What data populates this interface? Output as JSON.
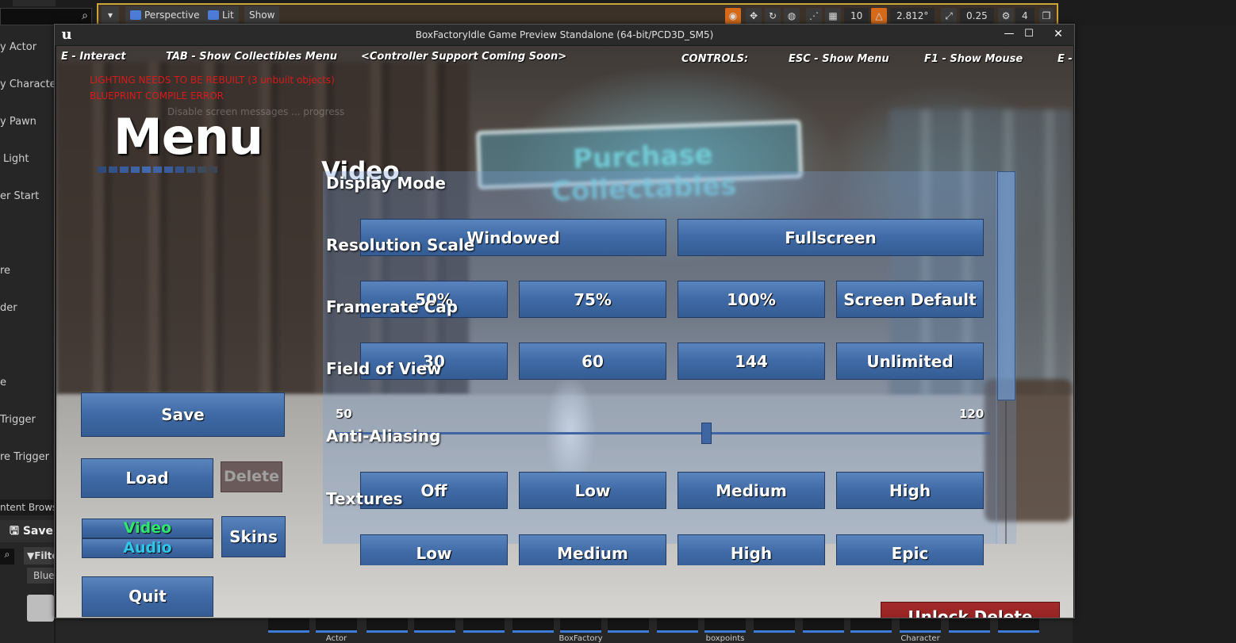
{
  "editor": {
    "viewport_buttons": [
      "Perspective",
      "Lit",
      "Show"
    ],
    "viewport_values": [
      "10",
      "2.812°",
      "0.25",
      "4"
    ],
    "left_panel_items": [
      "y Actor",
      "y Character",
      "y Pawn",
      "Light",
      "er Start",
      "re",
      "der",
      "e",
      "Trigger",
      "re Trigger"
    ],
    "content_browser_title": "ntent Browse",
    "save_label": "Save",
    "filter_label": "Filte",
    "blue_label": "Blue",
    "bottom_thumbs": [
      "Actor",
      "BoxFactory",
      "boxpoints",
      "Character"
    ]
  },
  "window": {
    "title": "BoxFactoryIdle Game Preview Standalone (64-bit/PCD3D_SM5)",
    "controls": {
      "minimize": "—",
      "maximize": "☐",
      "close": "✕"
    }
  },
  "hud": {
    "interact": "E - Interact",
    "collectibles": "TAB - Show Collectibles Menu",
    "controller": "<Controller Support Coming Soon>",
    "controls_label": "CONTROLS:",
    "esc": "ESC - Show Menu",
    "f1": "F1 - Show Mouse",
    "e_more": "E -"
  },
  "errors": {
    "lighting": "LIGHTING NEEDS TO BE REBUILT (3 unbuilt objects)",
    "blueprint": "BLUEPRINT COMPILE ERROR",
    "faint": "Disable screen messages ... progress"
  },
  "scene": {
    "sign_text": "Purchase Collectables"
  },
  "menu": {
    "title": "Menu",
    "save": "Save",
    "load": "Load",
    "delete": "Delete",
    "video": "Video",
    "audio": "Audio",
    "skins": "Skins",
    "quit": "Quit",
    "unlock_delete": "Unlock Delete Button"
  },
  "video": {
    "title": "Video",
    "display_mode": {
      "label": "Display Mode",
      "options": [
        "Windowed",
        "Fullscreen"
      ]
    },
    "resolution_scale": {
      "label": "Resolution Scale",
      "options": [
        "50%",
        "75%",
        "100%",
        "Screen Default"
      ]
    },
    "framerate_cap": {
      "label": "Framerate Cap",
      "options": [
        "30",
        "60",
        "144",
        "Unlimited"
      ]
    },
    "field_of_view": {
      "label": "Field of View",
      "min": "50",
      "max": "120",
      "value_fraction": 0.57
    },
    "anti_aliasing": {
      "label": "Anti-Aliasing",
      "options": [
        "Off",
        "Low",
        "Medium",
        "High"
      ]
    },
    "textures": {
      "label": "Textures",
      "options": [
        "Low",
        "Medium",
        "High",
        "Epic"
      ]
    }
  },
  "colors": {
    "button_blue": "#3f6aa6",
    "button_red": "#8a1e1e",
    "error_red": "#d61b1b",
    "video_green": "#2fe86b",
    "audio_cyan": "#2fc6e8"
  }
}
